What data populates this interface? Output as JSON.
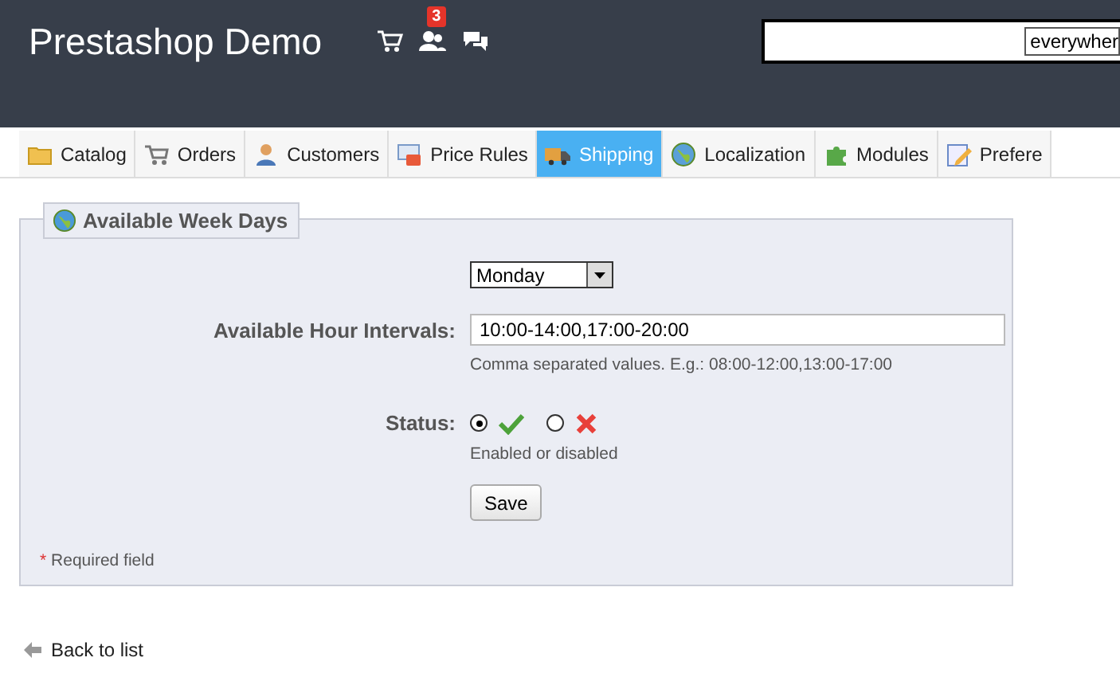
{
  "header": {
    "title": "Prestashop Demo",
    "notifications": [
      {
        "kind": "cart"
      },
      {
        "kind": "customers",
        "badge": "3"
      },
      {
        "kind": "messages"
      }
    ],
    "search": {
      "scope": "everywher"
    }
  },
  "tabs": [
    {
      "label": "Catalog",
      "kind": "folder",
      "selected": false
    },
    {
      "label": "Orders",
      "kind": "cart",
      "selected": false
    },
    {
      "label": "Customers",
      "kind": "person",
      "selected": false
    },
    {
      "label": "Price Rules",
      "kind": "card",
      "selected": false
    },
    {
      "label": "Shipping",
      "kind": "truck",
      "selected": true
    },
    {
      "label": "Localization",
      "kind": "globe",
      "selected": false
    },
    {
      "label": "Modules",
      "kind": "puzzle",
      "selected": false
    },
    {
      "label": "Prefere",
      "kind": "edit",
      "selected": false
    }
  ],
  "form": {
    "legend": "Available Week Days",
    "day": "Monday",
    "intervals": {
      "label": "Available Hour Intervals:",
      "value": "10:00-14:00,17:00-20:00",
      "hint": "Comma separated values. E.g.: 08:00-12:00,13:00-17:00"
    },
    "status": {
      "label": "Status:",
      "options": [
        {
          "kind": "enabled",
          "selected": true
        },
        {
          "kind": "disabled",
          "selected": false
        }
      ],
      "hint": "Enabled or disabled"
    },
    "save": "Save",
    "required_mark": "*",
    "required_note": "Required field"
  },
  "back_link": "Back to list"
}
